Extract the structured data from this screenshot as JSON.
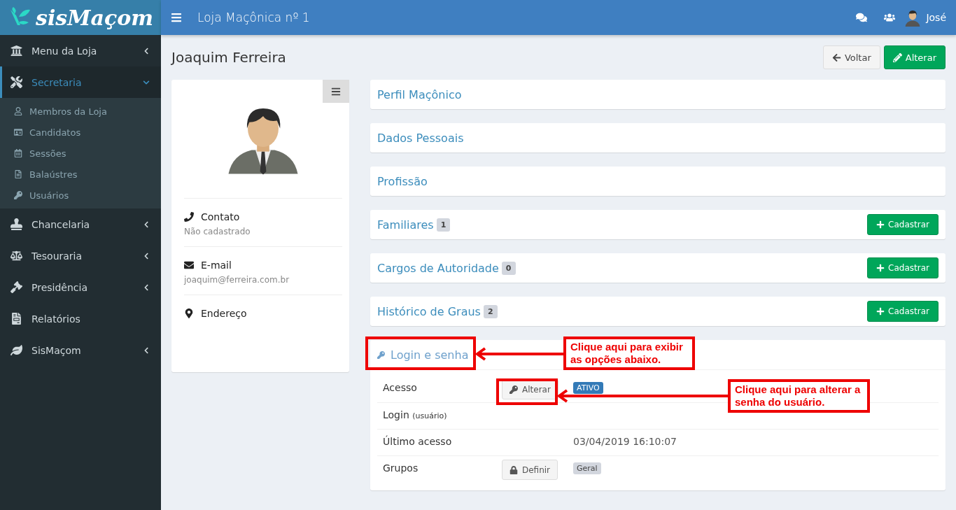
{
  "brand": "sisMaçom",
  "topbar": {
    "title": "Loja Maçônica nº 1",
    "user": "José"
  },
  "sidebar": {
    "items": [
      {
        "label": "Menu da Loja",
        "kind": "menu",
        "selected": false,
        "expanded": false
      },
      {
        "label": "Secretaria",
        "kind": "menu",
        "selected": true,
        "expanded": true,
        "children": [
          {
            "label": "Membros da Loja"
          },
          {
            "label": "Candidatos"
          },
          {
            "label": "Sessões"
          },
          {
            "label": "Balaústres"
          },
          {
            "label": "Usuários"
          }
        ]
      },
      {
        "label": "Chancelaria",
        "kind": "menu",
        "selected": false,
        "expanded": false
      },
      {
        "label": "Tesouraria",
        "kind": "menu",
        "selected": false,
        "expanded": false
      },
      {
        "label": "Presidência",
        "kind": "menu",
        "selected": false,
        "expanded": false
      },
      {
        "label": "Relatórios",
        "kind": "link",
        "selected": false
      },
      {
        "label": "SisMaçom",
        "kind": "menu",
        "selected": false,
        "expanded": false
      }
    ]
  },
  "page": {
    "title": "Joaquim Ferreira",
    "buttons": [
      {
        "label": "Voltar",
        "kind": "back"
      },
      {
        "label": "Alterar",
        "kind": "edit"
      }
    ]
  },
  "profile": {
    "contacts": [
      {
        "label": "Contato",
        "value": "Não cadastrado"
      },
      {
        "label": "E-mail",
        "value": "joaquim@ferreira.com.br"
      },
      {
        "label": "Endereço"
      }
    ]
  },
  "panels": [
    {
      "title": "Perfil Maçônico"
    },
    {
      "title": "Dados Pessoais"
    },
    {
      "title": "Profissão"
    },
    {
      "title": "Familiares",
      "count": "1",
      "action": "Cadastrar"
    },
    {
      "title": "Cargos de Autoridade",
      "count": "0",
      "action": "Cadastrar"
    },
    {
      "title": "Histórico de Graus",
      "count": "2",
      "action": "Cadastrar"
    }
  ],
  "login_panel": {
    "title": "Login e senha",
    "expanded": true,
    "rows": [
      {
        "kind": "status",
        "label": "Acesso",
        "button": "Alterar",
        "badge": "ATIVO"
      },
      {
        "kind": "text",
        "label": "Login",
        "note": "(usuário)"
      },
      {
        "kind": "text",
        "label": "Último acesso",
        "value": "03/04/2019 16:10:07"
      },
      {
        "kind": "groups",
        "label": "Grupos",
        "button": "Definir",
        "badge": "Geral"
      }
    ]
  },
  "annotations": [
    {
      "text": "Clique aqui para exibir as opções abaixo."
    },
    {
      "text": "Clique aqui para alterar a senha do usuário."
    }
  ]
}
